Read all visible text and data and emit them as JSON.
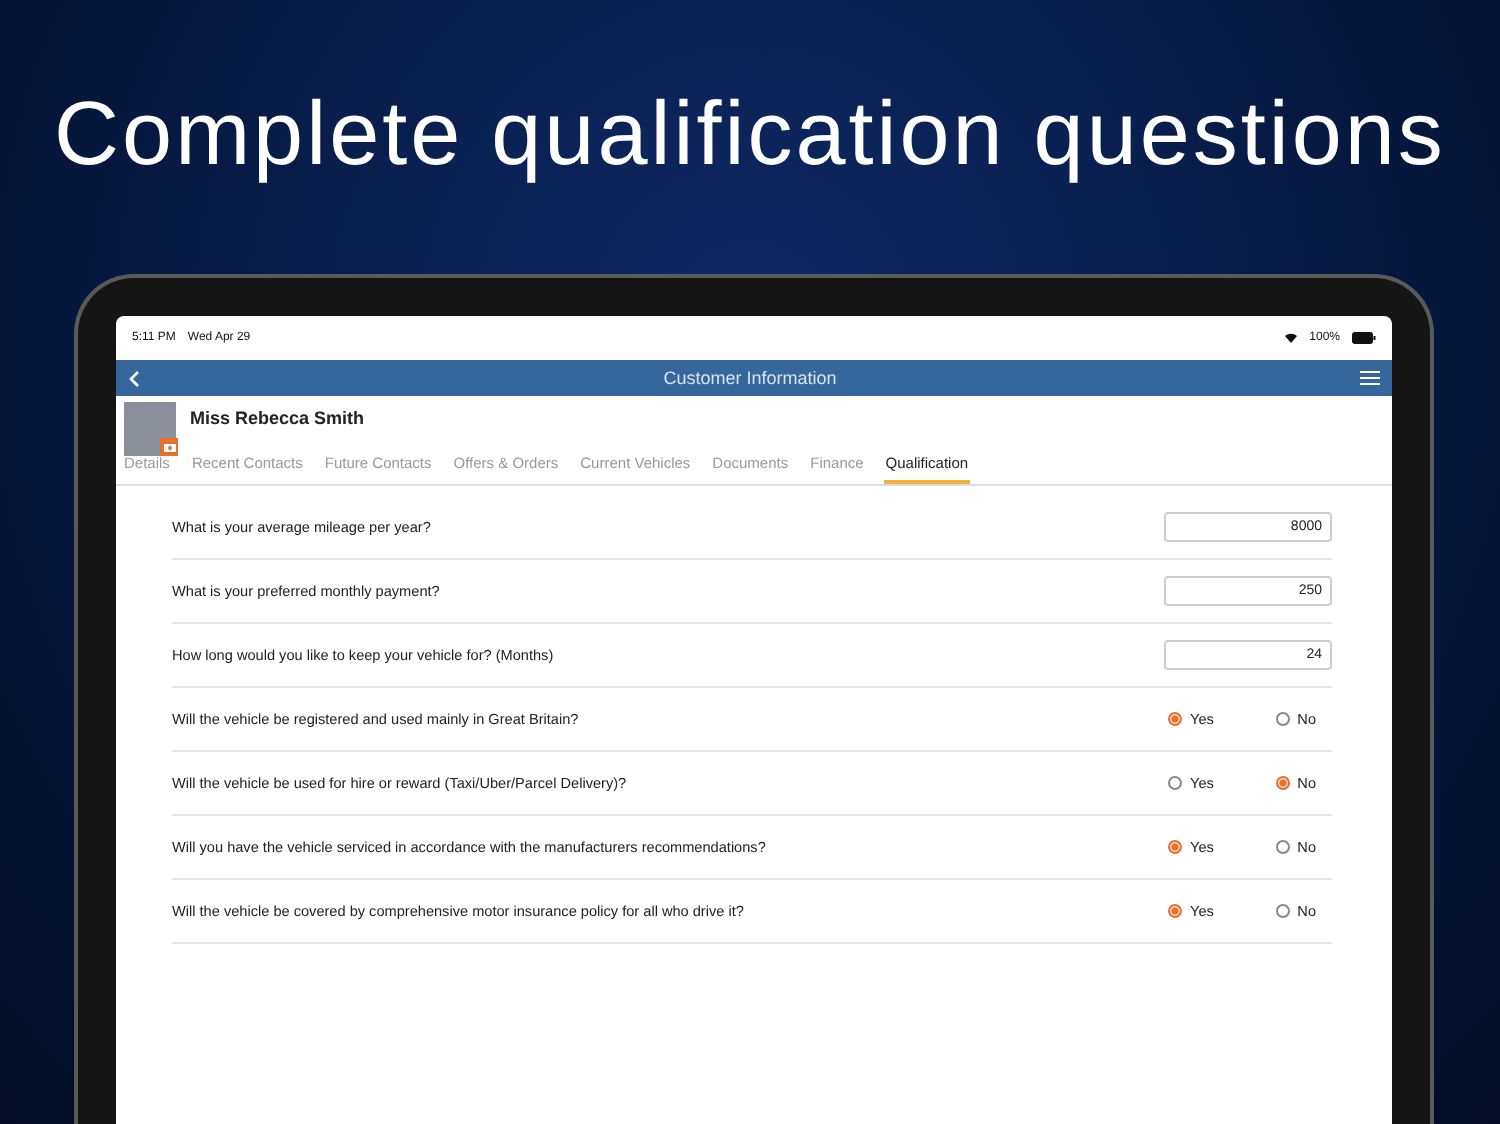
{
  "headline": "Complete qualification questions",
  "status_bar": {
    "time": "5:11 PM",
    "date": "Wed Apr 29",
    "battery": "100%"
  },
  "nav_bar": {
    "title": "Customer Information"
  },
  "customer": {
    "name": "Miss Rebecca Smith"
  },
  "tabs": [
    {
      "label": "Details",
      "selected": false
    },
    {
      "label": "Recent Contacts",
      "selected": false
    },
    {
      "label": "Future Contacts",
      "selected": false
    },
    {
      "label": "Offers & Orders",
      "selected": false
    },
    {
      "label": "Current Vehicles",
      "selected": false
    },
    {
      "label": "Documents",
      "selected": false
    },
    {
      "label": "Finance",
      "selected": false
    },
    {
      "label": "Qualification",
      "selected": true
    }
  ],
  "questions": [
    {
      "kind": "number",
      "text": "What is your average mileage per year?",
      "value": "8000"
    },
    {
      "kind": "number",
      "text": "What is your preferred monthly payment?",
      "value": "250"
    },
    {
      "kind": "number",
      "text": "How long would you like to keep your vehicle for? (Months)",
      "value": "24"
    },
    {
      "kind": "choice",
      "text": "Will the vehicle be registered and used mainly in Great Britain?",
      "options": [
        {
          "label": "Yes",
          "selected": true
        },
        {
          "label": "No",
          "selected": false
        }
      ]
    },
    {
      "kind": "choice",
      "text": "Will the vehicle be used for hire or reward (Taxi/Uber/Parcel Delivery)?",
      "options": [
        {
          "label": "Yes",
          "selected": false
        },
        {
          "label": "No",
          "selected": true
        }
      ]
    },
    {
      "kind": "choice",
      "text": "Will you have the vehicle serviced in accordance with the manufacturers recommendations?",
      "options": [
        {
          "label": "Yes",
          "selected": true
        },
        {
          "label": "No",
          "selected": false
        }
      ]
    },
    {
      "kind": "choice",
      "text": "Will the vehicle be covered by comprehensive motor insurance policy for all who drive it?",
      "options": [
        {
          "label": "Yes",
          "selected": true
        },
        {
          "label": "No",
          "selected": false
        }
      ]
    }
  ]
}
